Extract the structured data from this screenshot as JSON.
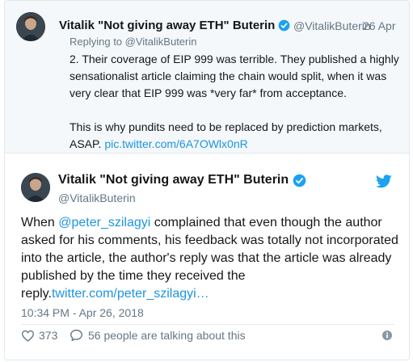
{
  "parent_tweet": {
    "author_name": "Vitalik \"Not giving away ETH\" Buterin",
    "handle": "@VitalikButerin",
    "date": "26 Apr",
    "reply_prefix": "Replying to ",
    "reply_to": "@VitalikButerin",
    "text_para1": "2. Their coverage of EIP 999 was terrible. They published a highly sensationalist article claiming the chain would split, when it was very clear that EIP 999 was *very far* from acceptance.",
    "text_para2": "This is why pundits need to be replaced by prediction markets, ASAP. ",
    "link": "pic.twitter.com/6A7OWlx0nR"
  },
  "main_tweet": {
    "author_name": "Vitalik \"Not giving away ETH\" Buterin",
    "handle": "@VitalikButerin",
    "text_before": "When ",
    "mention": "@peter_szilagyi",
    "text_after": " complained that even though the author asked for his comments, his feedback was totally not incorporated into the article, the author's reply was that the article was already published by the time they received the reply.",
    "link": "twitter.com/peter_szilagyi…",
    "timestamp": "10:34 PM - Apr 26, 2018",
    "likes": "373",
    "talking": "56 people are talking about this"
  },
  "colors": {
    "link": "#1b95e0",
    "verified": "#1da1f2",
    "muted": "#657786"
  },
  "icons": [
    "verified-badge-icon",
    "twitter-bird-icon",
    "heart-icon",
    "speech-bubble-icon",
    "info-icon"
  ]
}
